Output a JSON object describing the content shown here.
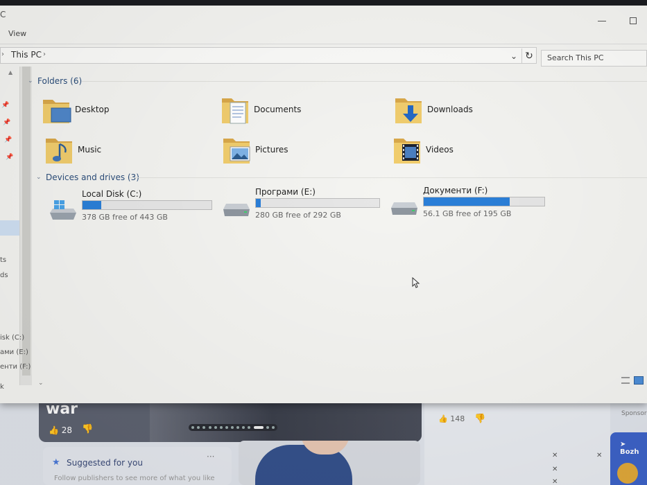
{
  "window": {
    "title_fragment": "C",
    "ribbon_tab": "View"
  },
  "address_bar": {
    "location": "This PC",
    "search_placeholder": "Search This PC"
  },
  "navigation_pane": {
    "items": [
      "ts",
      "ds",
      "isk (C:)",
      "ами (E:)",
      "енти (F:)",
      "k"
    ]
  },
  "content": {
    "folders_header": "Folders (6)",
    "folders": [
      {
        "label": "Desktop",
        "icon": "desktop-folder-icon"
      },
      {
        "label": "Documents",
        "icon": "documents-folder-icon"
      },
      {
        "label": "Downloads",
        "icon": "downloads-folder-icon"
      },
      {
        "label": "Music",
        "icon": "music-folder-icon"
      },
      {
        "label": "Pictures",
        "icon": "pictures-folder-icon"
      },
      {
        "label": "Videos",
        "icon": "videos-folder-icon"
      }
    ],
    "drives_header": "Devices and drives (3)",
    "drives": [
      {
        "name": "Local Disk (C:)",
        "free_text": "378 GB free of 443 GB",
        "used_fraction": 0.147,
        "icon": "windows-drive-icon"
      },
      {
        "name": "Програми (E:)",
        "free_text": "280 GB free of 292 GB",
        "used_fraction": 0.041,
        "icon": "hard-drive-icon"
      },
      {
        "name": "Документи (F:)",
        "free_text": "56.1 GB free of 195 GB",
        "used_fraction": 0.712,
        "icon": "hard-drive-icon"
      }
    ]
  },
  "background_page": {
    "headline_word": "war",
    "likes_left": "28",
    "likes_right": "148",
    "sponsored": "Sponsore",
    "suggested_title": "Suggested for you",
    "suggested_sub": "Follow publishers to see more of what you like",
    "blue_card_text": "Bozh"
  },
  "colors": {
    "drive_bar_fill": "#2a7fd8",
    "group_header": "#2b4d7a",
    "folder_yellow": "#e8c15e"
  }
}
